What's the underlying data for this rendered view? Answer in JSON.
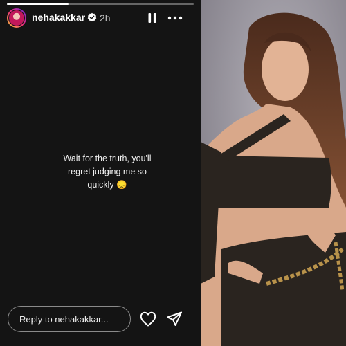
{
  "story": {
    "username": "nehakakkar",
    "time": "2h",
    "caption_line1": "Wait for the truth, you'll",
    "caption_line2": "regret judging me so",
    "caption_line3": "quickly 😞",
    "reply_placeholder": "Reply to nehakakkar...",
    "progress": 0.33
  },
  "icons": {
    "verified": "verified-badge-icon",
    "pause": "pause-icon",
    "more": "more-options-icon",
    "like": "heart-icon",
    "share": "send-icon"
  },
  "colors": {
    "story_background": "#141414",
    "photo_background": "#8c8993",
    "outfit": "#2a241f",
    "chain": "#b8924a"
  }
}
